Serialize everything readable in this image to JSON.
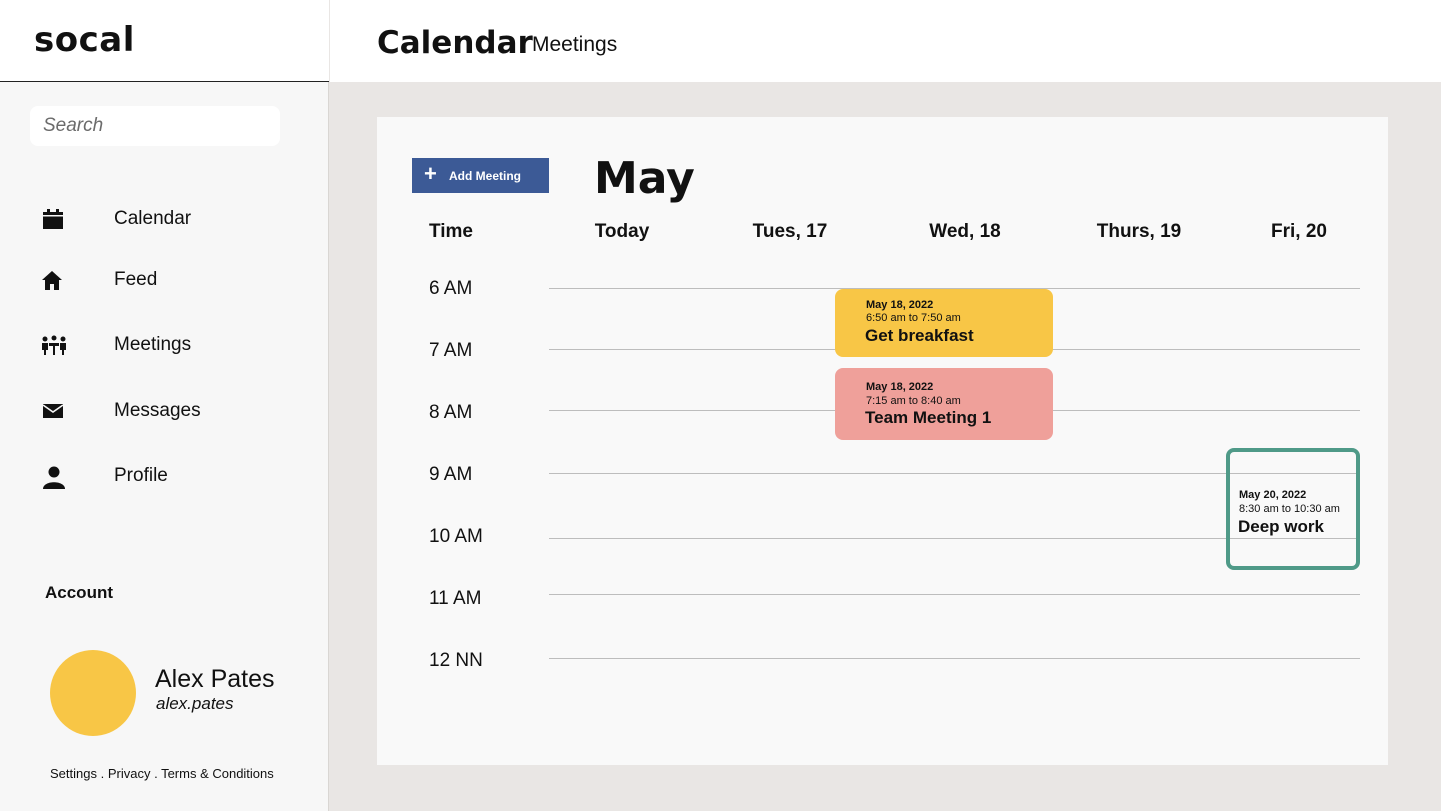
{
  "app": {
    "name": "socal"
  },
  "header": {
    "title": "Calendar",
    "subtitle": "Meetings"
  },
  "search": {
    "placeholder": "Search",
    "value": ""
  },
  "sidebar": {
    "items": [
      {
        "label": "Calendar",
        "icon": "calendar-icon"
      },
      {
        "label": "Feed",
        "icon": "home-icon"
      },
      {
        "label": "Meetings",
        "icon": "meeting-icon"
      },
      {
        "label": "Messages",
        "icon": "mail-icon"
      },
      {
        "label": "Profile",
        "icon": "person-icon"
      }
    ]
  },
  "account": {
    "label": "Account",
    "name": "Alex Pates",
    "handle": "alex.pates",
    "avatar_color": "#f8c646"
  },
  "footer": {
    "settings": "Settings",
    "privacy": "Privacy",
    "terms": "Terms & Conditions",
    "separator": " . "
  },
  "calendar": {
    "add_button": "Add Meeting",
    "month": "May",
    "time_header": "Time",
    "days": [
      "Today",
      "Tues, 17",
      "Wed, 18",
      "Thurs, 19",
      "Fri, 20"
    ],
    "hours": [
      "6 AM",
      "7 AM",
      "8 AM",
      "9 AM",
      "10 AM",
      "11 AM",
      "12 NN"
    ],
    "events": [
      {
        "date": "May 18, 2022",
        "time": "6:50 am to 7:50 am",
        "title": "Get breakfast",
        "color": "#f8c646"
      },
      {
        "date": "May 18, 2022",
        "time": "7:15 am to 8:40 am",
        "title": "Team Meeting 1",
        "color": "#efa09a"
      },
      {
        "date": "May 20, 2022",
        "time": "8:30 am to 10:30 am",
        "title": "Deep work",
        "color": "#4f9a88"
      }
    ]
  },
  "colors": {
    "accent": "#3c5a96",
    "background": "#e9e6e4"
  }
}
